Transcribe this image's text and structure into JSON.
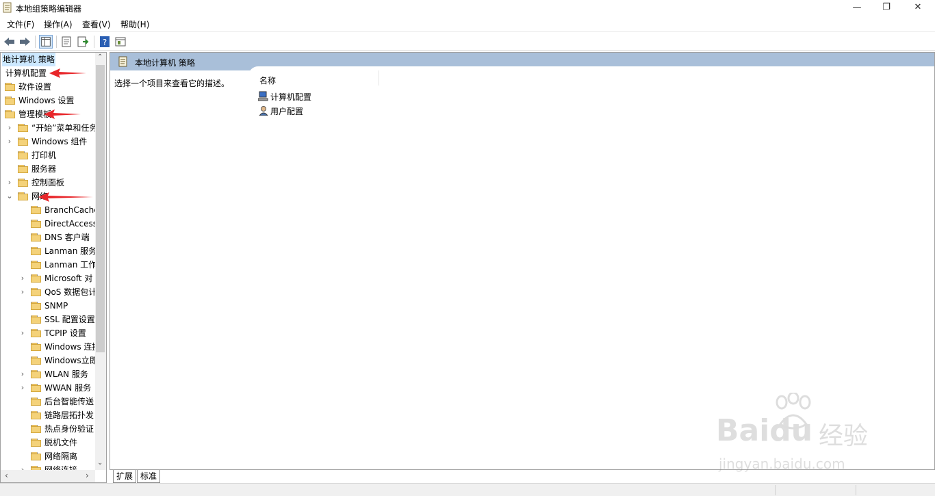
{
  "window": {
    "title": "本地组策略编辑器",
    "controls": {
      "minimize": "—",
      "restore": "❐",
      "close": "✕"
    }
  },
  "menu": [
    "文件(F)",
    "操作(A)",
    "查看(V)",
    "帮助(H)"
  ],
  "tree": {
    "items": [
      {
        "label": "地计算机 策略",
        "selected": true
      },
      {
        "label": "计算机配置"
      },
      {
        "label": "软件设置"
      },
      {
        "label": "Windows 设置"
      },
      {
        "label": "管理模板"
      },
      {
        "label": "“开始”菜单和任务"
      },
      {
        "label": "Windows 组件"
      },
      {
        "label": "打印机"
      },
      {
        "label": "服务器"
      },
      {
        "label": "控制面板"
      },
      {
        "label": "网络"
      },
      {
        "label": "BranchCache"
      },
      {
        "label": "DirectAccess"
      },
      {
        "label": "DNS 客户端"
      },
      {
        "label": "Lanman 服务"
      },
      {
        "label": "Lanman 工作"
      },
      {
        "label": "Microsoft 对"
      },
      {
        "label": "QoS 数据包计"
      },
      {
        "label": "SNMP"
      },
      {
        "label": "SSL 配置设置"
      },
      {
        "label": "TCPIP 设置"
      },
      {
        "label": "Windows 连接"
      },
      {
        "label": "Windows立即"
      },
      {
        "label": "WLAN 服务"
      },
      {
        "label": "WWAN 服务"
      },
      {
        "label": "后台智能传送"
      },
      {
        "label": "链路层拓扑发"
      },
      {
        "label": "热点身份验证"
      },
      {
        "label": "脱机文件"
      },
      {
        "label": "网络隔离"
      },
      {
        "label": "网络连接"
      }
    ]
  },
  "right": {
    "header": "本地计算机 策略",
    "description": "选择一个项目来查看它的描述。",
    "column_name": "名称",
    "rows": [
      "计算机配置",
      "用户配置"
    ]
  },
  "tabs": [
    "扩展",
    "标准"
  ],
  "watermark": {
    "brand": "Baidu",
    "cn": "经验",
    "url": "jingyan.baidu.com"
  },
  "colors": {
    "header_bg": "#a9bfd9",
    "arrow": "#e8262a",
    "selection": "#cce8ff"
  }
}
